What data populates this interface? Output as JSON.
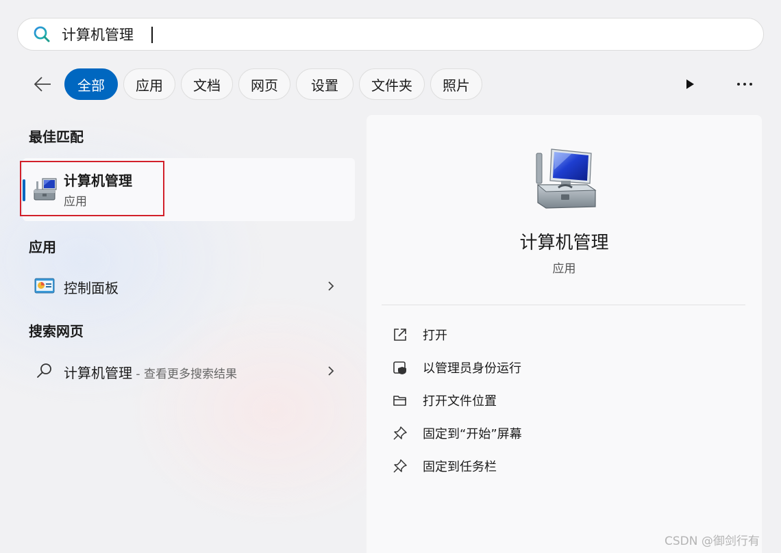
{
  "search": {
    "value": "计算机管理"
  },
  "filters": {
    "tabs": [
      "全部",
      "应用",
      "文档",
      "网页",
      "设置",
      "文件夹",
      "照片"
    ],
    "active_index": 0
  },
  "best_match": {
    "heading": "最佳匹配",
    "title": "计算机管理",
    "subtitle": "应用"
  },
  "apps": {
    "heading": "应用",
    "items": [
      {
        "label": "控制面板"
      }
    ]
  },
  "web": {
    "heading": "搜索网页",
    "items": [
      {
        "label": "计算机管理",
        "suffix": " - 查看更多搜索结果"
      }
    ]
  },
  "detail": {
    "title": "计算机管理",
    "subtitle": "应用",
    "actions": [
      {
        "label": "打开",
        "icon": "open-external-icon"
      },
      {
        "label": "以管理员身份运行",
        "icon": "shield-admin-icon"
      },
      {
        "label": "打开文件位置",
        "icon": "folder-icon"
      },
      {
        "label": "固定到“开始”屏幕",
        "icon": "pin-icon"
      },
      {
        "label": "固定到任务栏",
        "icon": "pin-icon"
      }
    ]
  },
  "watermark": "CSDN @御剑行有",
  "colors": {
    "accent": "#0067c0",
    "highlight": "#d2202a"
  }
}
